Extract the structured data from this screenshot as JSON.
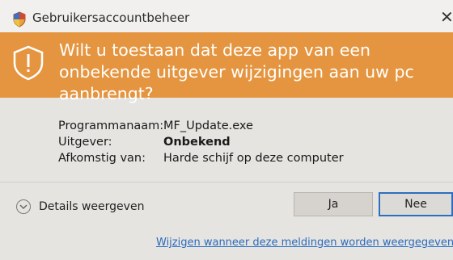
{
  "titlebar": {
    "title": "Gebruikersaccountbeheer",
    "close_label": "✕"
  },
  "banner": {
    "question": "Wilt u toestaan dat deze app van een onbekende uitgever wijzigingen aan uw pc aanbrengt?",
    "color": "#e5953f"
  },
  "info": {
    "rows": [
      {
        "label": "Programmanaam:",
        "value": "MF_Update.exe"
      },
      {
        "label": "Uitgever:",
        "value": "Onbekend"
      },
      {
        "label": "Afkomstig van:",
        "value": "Harde schijf op deze computer"
      }
    ]
  },
  "footer": {
    "details_label": "Details weergeven",
    "yes_label": "Ja",
    "no_label": "Nee",
    "link_text": "Wijzigen wanneer deze meldingen worden weergegeven"
  },
  "icons": {
    "title": "shield-icon",
    "banner": "warning-shield-icon",
    "details": "chevron-down-icon"
  }
}
